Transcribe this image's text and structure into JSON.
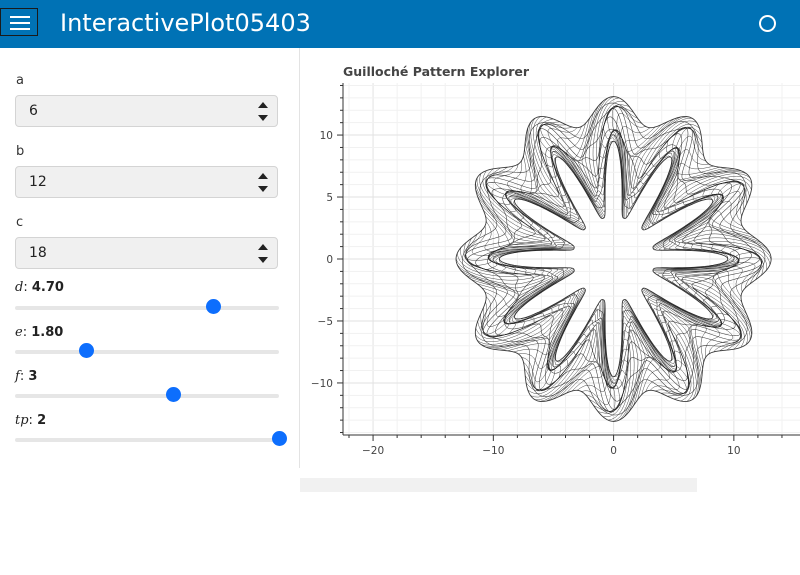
{
  "app": {
    "title": "InteractivePlot05403"
  },
  "widgets": {
    "a": {
      "label": "a",
      "value": "6"
    },
    "b": {
      "label": "b",
      "value": "12"
    },
    "c": {
      "label": "c",
      "value": "18"
    },
    "d": {
      "symbol": "d",
      "value": "4.70",
      "fraction": 0.75
    },
    "e": {
      "symbol": "e",
      "value": "1.80",
      "fraction": 0.27
    },
    "f": {
      "symbol": "f",
      "value": "3",
      "fraction": 0.6
    },
    "tp": {
      "symbol": "tp",
      "value": "2",
      "fraction": 1.0
    }
  },
  "colors": {
    "header": "#0072b5",
    "slider_thumb": "#0d6efd",
    "curve": "#1a1a1a"
  },
  "chart_data": {
    "type": "line",
    "title": "Guilloché Pattern Explorer",
    "xlabel": "",
    "ylabel": "",
    "xlim": [
      -22.5,
      15.5
    ],
    "ylim": [
      -14.2,
      14.2
    ],
    "x_ticks": [
      -20,
      -10,
      0,
      10
    ],
    "y_ticks": [
      -10,
      -5,
      0,
      5,
      10
    ],
    "grid": true,
    "series": [
      {
        "kind": "parametric-guilloche",
        "petals": 12,
        "outer_radius_max": 13.1,
        "outer_radius_min": 11.0,
        "inner_radius_max": 9.5,
        "inner_radius_min": 3.4,
        "rings": 10
      }
    ]
  }
}
